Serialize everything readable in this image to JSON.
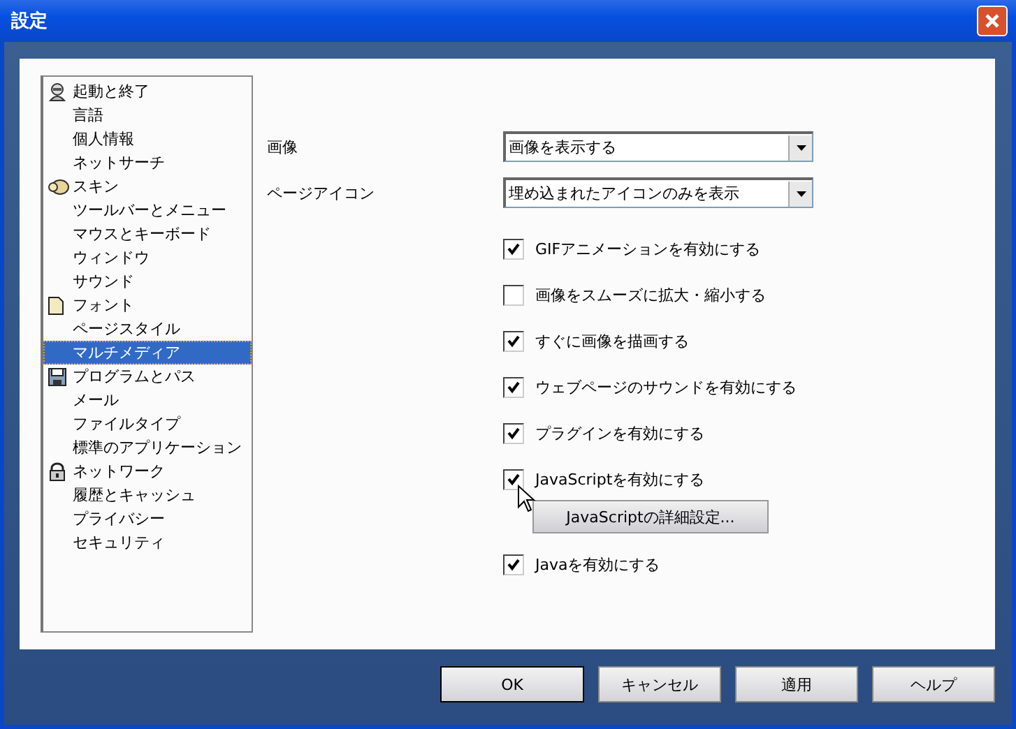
{
  "window": {
    "title": "設定"
  },
  "sidebar": {
    "groups": [
      {
        "label": "起動と終了",
        "selected": false,
        "children": [
          {
            "label": "言語",
            "selected": false
          },
          {
            "label": "個人情報",
            "selected": false
          },
          {
            "label": "ネットサーチ",
            "selected": false
          }
        ]
      },
      {
        "label": "スキン",
        "selected": false,
        "children": [
          {
            "label": "ツールバーとメニュー",
            "selected": false
          },
          {
            "label": "マウスとキーボード",
            "selected": false
          },
          {
            "label": "ウィンドウ",
            "selected": false
          },
          {
            "label": "サウンド",
            "selected": false
          }
        ]
      },
      {
        "label": "フォント",
        "selected": false,
        "children": [
          {
            "label": "ページスタイル",
            "selected": false
          },
          {
            "label": "マルチメディア",
            "selected": true
          }
        ]
      },
      {
        "label": "プログラムとパス",
        "selected": false,
        "children": [
          {
            "label": "メール",
            "selected": false
          },
          {
            "label": "ファイルタイプ",
            "selected": false
          },
          {
            "label": "標準のアプリケーション",
            "selected": false
          }
        ]
      },
      {
        "label": "ネットワーク",
        "selected": false,
        "children": [
          {
            "label": "履歴とキャッシュ",
            "selected": false
          },
          {
            "label": "プライバシー",
            "selected": false
          },
          {
            "label": "セキュリティ",
            "selected": false
          }
        ]
      }
    ]
  },
  "fields": [
    {
      "label": "画像",
      "value": "画像を表示する"
    },
    {
      "label": "ページアイコン",
      "value": "埋め込まれたアイコンのみを表示"
    }
  ],
  "options": [
    {
      "kind": "checkbox",
      "label": "GIFアニメーションを有効にする",
      "checked": true
    },
    {
      "kind": "checkbox",
      "label": "画像をスムーズに拡大・縮小する",
      "checked": false
    },
    {
      "kind": "checkbox",
      "label": "すぐに画像を描画する",
      "checked": true
    },
    {
      "kind": "checkbox",
      "label": "ウェブページのサウンドを有効にする",
      "checked": true
    },
    {
      "kind": "checkbox",
      "label": "プラグインを有効にする",
      "checked": true
    },
    {
      "kind": "checkbox",
      "label": "JavaScriptを有効にする",
      "checked": true,
      "cursor": true
    },
    {
      "kind": "button",
      "label": "JavaScriptの詳細設定..."
    },
    {
      "kind": "checkbox",
      "label": "Javaを有効にする",
      "checked": true
    }
  ],
  "buttons": [
    {
      "label": "OK",
      "default": true
    },
    {
      "label": "キャンセル",
      "default": false
    },
    {
      "label": "適用",
      "default": false
    },
    {
      "label": "ヘルプ",
      "default": false
    }
  ]
}
